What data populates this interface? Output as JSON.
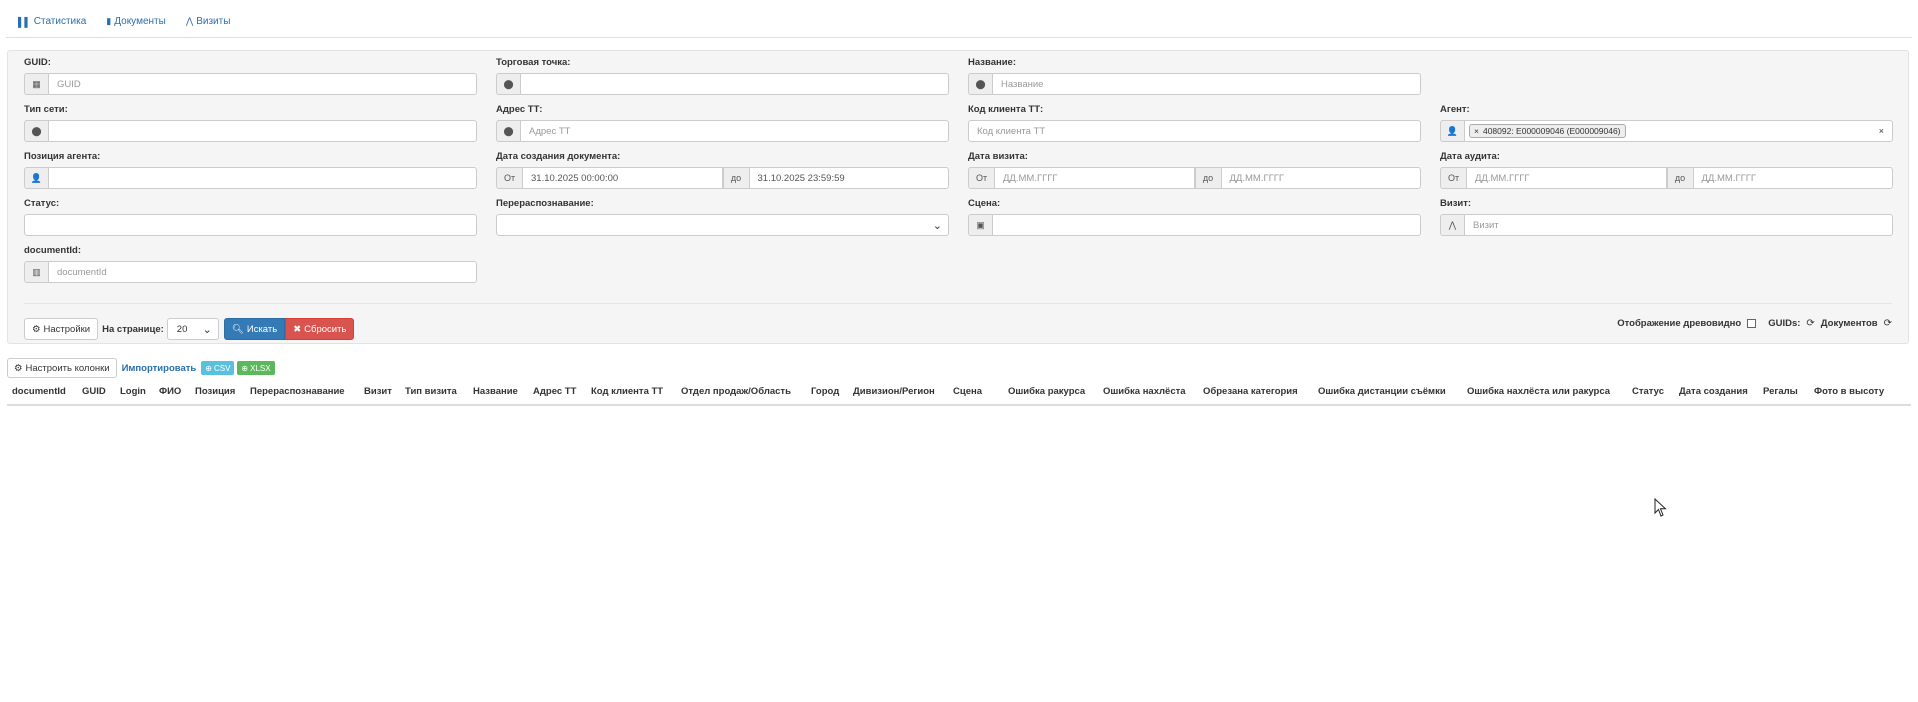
{
  "nav": [
    {
      "icon": "bar-chart-icon",
      "glyph": "▌▌",
      "label": "Статистика"
    },
    {
      "icon": "file-icon",
      "glyph": "▮",
      "label": "Документы"
    },
    {
      "icon": "road-icon",
      "glyph": "⋀",
      "label": "Визиты"
    }
  ],
  "filters": {
    "guid": {
      "label": "GUID:",
      "placeholder": "GUID"
    },
    "outlet": {
      "label": "Торговая точка:"
    },
    "name": {
      "label": "Название:",
      "placeholder": "Название"
    },
    "network_type": {
      "label": "Тип сети:"
    },
    "address": {
      "label": "Адрес ТТ:",
      "placeholder": "Адрес ТТ"
    },
    "client_code": {
      "label": "Код клиента ТТ:",
      "placeholder": "Код клиента ТТ"
    },
    "agent": {
      "label": "Агент:",
      "tag": "408092: E000009046 (E000009046)",
      "tag_remove": "×",
      "clear": "×"
    },
    "agent_position": {
      "label": "Позиция агента:"
    },
    "doc_created": {
      "label": "Дата создания документа:",
      "from_label": "От",
      "from_value": "31.10.2025 00:00:00",
      "to_label": "до",
      "to_value": "31.10.2025 23:59:59"
    },
    "visit_date": {
      "label": "Дата визита:",
      "from_label": "От",
      "from_placeholder": "ДД.ММ.ГГГГ",
      "to_label": "до",
      "to_placeholder": "ДД.ММ.ГГГГ"
    },
    "audit_date": {
      "label": "Дата аудита:",
      "from_label": "От",
      "from_placeholder": "ДД.ММ.ГГГГ",
      "to_label": "до",
      "to_placeholder": "ДД.ММ.ГГГГ"
    },
    "status": {
      "label": "Статус:"
    },
    "rerecognition": {
      "label": "Перераспознавание:"
    },
    "scene": {
      "label": "Сцена:"
    },
    "visit": {
      "label": "Визит:",
      "placeholder": "Визит"
    },
    "document_id": {
      "label": "documentId:",
      "placeholder": "documentId"
    }
  },
  "controls": {
    "settings_label": "Настройки",
    "per_page_label": "На странице:",
    "per_page_value": "20",
    "search_label": "Искать",
    "reset_label": "Сбросить",
    "tree_view_label": "Отображение древовидно",
    "guids_label": "GUIDs:",
    "documents_label": "Документов"
  },
  "table_tools": {
    "configure_columns": "Настроить колонки",
    "import": "Импортировать",
    "csv": "CSV",
    "xlsx": "XLSX"
  },
  "columns": [
    "documentId",
    "GUID",
    "Login",
    "ФИО",
    "Позиция",
    "Перераспознавание",
    "Визит",
    "Тип визита",
    "Название",
    "Адрес ТТ",
    "Код клиента ТТ",
    "Отдел продаж/Область",
    "Город",
    "Дивизион/Регион",
    "Сцена",
    "Ошибка ракурса",
    "Ошибка нахлёста",
    "Обрезана категория",
    "Ошибка дистанции съёмки",
    "Ошибка нахлёста или ракурса",
    "Статус",
    "Дата создания",
    "Регалы",
    "Фото в высоту"
  ],
  "colors": {
    "primary": "#337ab7",
    "danger": "#d9534f",
    "link": "#2a6ead",
    "csv": "#5bc0de",
    "xlsx": "#5cb85c"
  }
}
